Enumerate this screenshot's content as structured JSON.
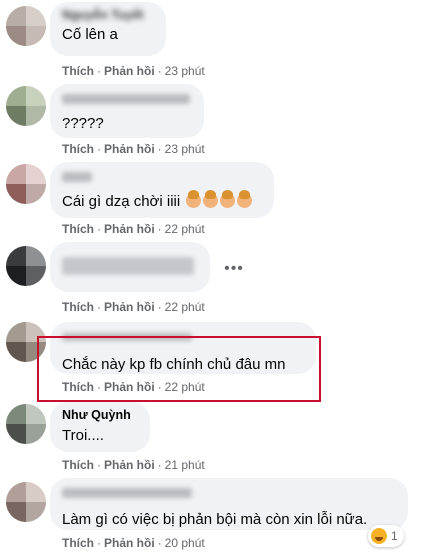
{
  "action_labels": {
    "like": "Thích",
    "reply": "Phản hồi",
    "separator": "·"
  },
  "comments": [
    {
      "author": "Nguyễn Tuyết",
      "text": "Cố lên a",
      "time": "23 phút",
      "author_blurred": true
    },
    {
      "author": "",
      "text": "?????",
      "time": "23 phút",
      "author_blurred": true
    },
    {
      "author": "",
      "text": "Cái gì dzạ chời iiii",
      "time": "22 phút",
      "author_blurred": true,
      "emoji_count": 4
    },
    {
      "author": "",
      "text": "",
      "time": "22 phút",
      "author_blurred": true
    },
    {
      "author": "",
      "text": "Chắc này kp fb chính chủ đâu mn",
      "time": "22 phút",
      "author_blurred": true
    },
    {
      "author": "Như Quỳnh",
      "text": "Troi....",
      "time": "21 phút",
      "author_blurred": false
    },
    {
      "author": "",
      "text": "Làm gì có việc bị phản bội mà còn xin lỗi nữa.",
      "time": "20 phút",
      "author_blurred": true
    }
  ],
  "more_icon": "ellipsis-icon",
  "reaction": {
    "icon": "haha-reaction-icon",
    "count": "1"
  },
  "colors": {
    "bubble": "#f0f2f5",
    "highlight": "#c8102e",
    "meta": "#65676b"
  }
}
